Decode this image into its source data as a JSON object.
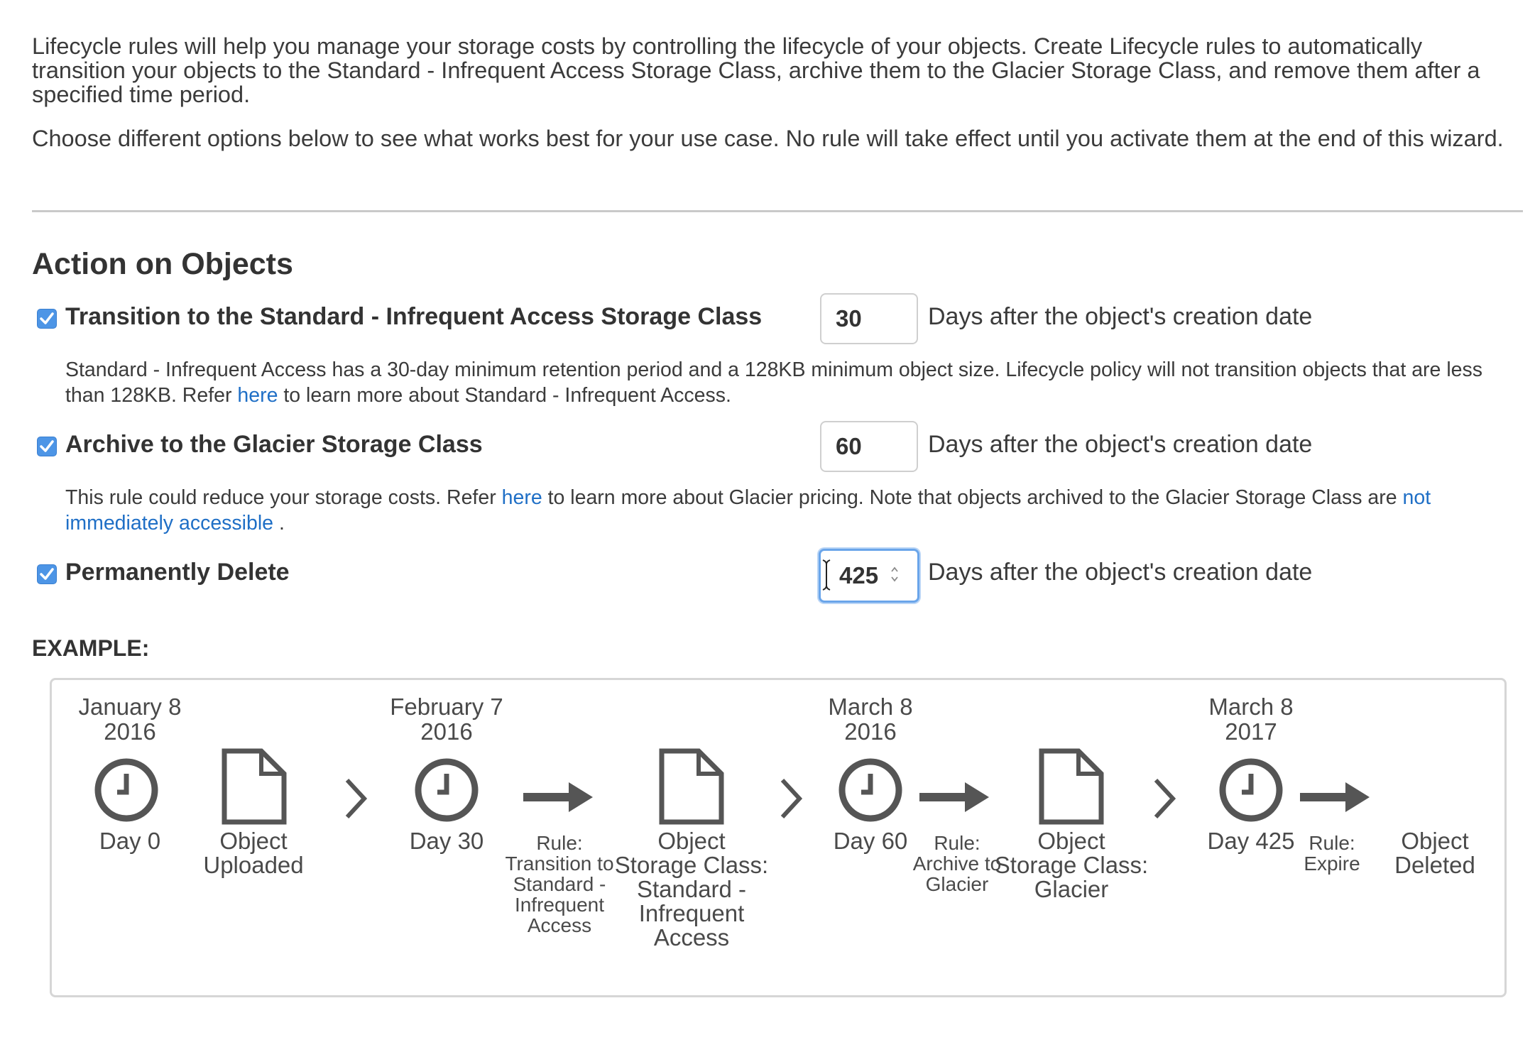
{
  "intro": {
    "paragraph1": "Lifecycle rules will help you manage your storage costs by controlling the lifecycle of your objects. Create Lifecycle rules to automatically transition your objects to the Standard - Infrequent Access Storage Class, archive them to the Glacier Storage Class, and remove them after a specified time period.",
    "paragraph2": "Choose different options below to see what works best for your use case. No rule will take effect until you activate them at the end of this wizard."
  },
  "section_title": "Action on Objects",
  "rules": [
    {
      "label": "Transition to the Standard - Infrequent Access Storage Class",
      "checked": true,
      "days": "30",
      "suffix": "Days after the object's creation date",
      "desc_before": "Standard - Infrequent Access has a 30-day minimum retention period and a 128KB minimum object size. Lifecycle policy will not transition objects that are less than 128KB. Refer ",
      "desc_link": "here",
      "desc_after": " to learn more about Standard - Infrequent Access."
    },
    {
      "label": "Archive to the Glacier Storage Class",
      "checked": true,
      "days": "60",
      "suffix": "Days after the object's creation date",
      "desc_before": "This rule could reduce your storage costs. Refer ",
      "desc_link": "here",
      "desc_middle": " to learn more about Glacier pricing. Note that objects archived to the Glacier Storage Class are ",
      "desc_link2": "not immediately accessible",
      "desc_after": " ."
    },
    {
      "label": "Permanently Delete",
      "checked": true,
      "days": "425",
      "suffix": "Days after the object's creation date"
    }
  ],
  "example": {
    "label": "EXAMPLE:",
    "dates": [
      {
        "line1": "January 8",
        "line2": "2016",
        "day": "Day 0"
      },
      {
        "line1": "February 7",
        "line2": "2016",
        "day": "Day 30"
      },
      {
        "line1": "March 8",
        "line2": "2016",
        "day": "Day 60"
      },
      {
        "line1": "March 8",
        "line2": "2017",
        "day": "Day 425"
      }
    ],
    "objects": [
      "Object Uploaded",
      "Object Storage Class: Standard - Infrequent Access",
      "Object Storage Class: Glacier",
      "Object Deleted"
    ],
    "rules": [
      "Rule: Transition to Standard - Infrequent Access",
      "Rule: Archive to Glacier",
      "Rule: Expire"
    ]
  },
  "colors": {
    "checkbox": "#4d95e6",
    "link": "#1f6fc6",
    "focus_border": "#6aa5ea",
    "icon_gray": "#555555"
  }
}
